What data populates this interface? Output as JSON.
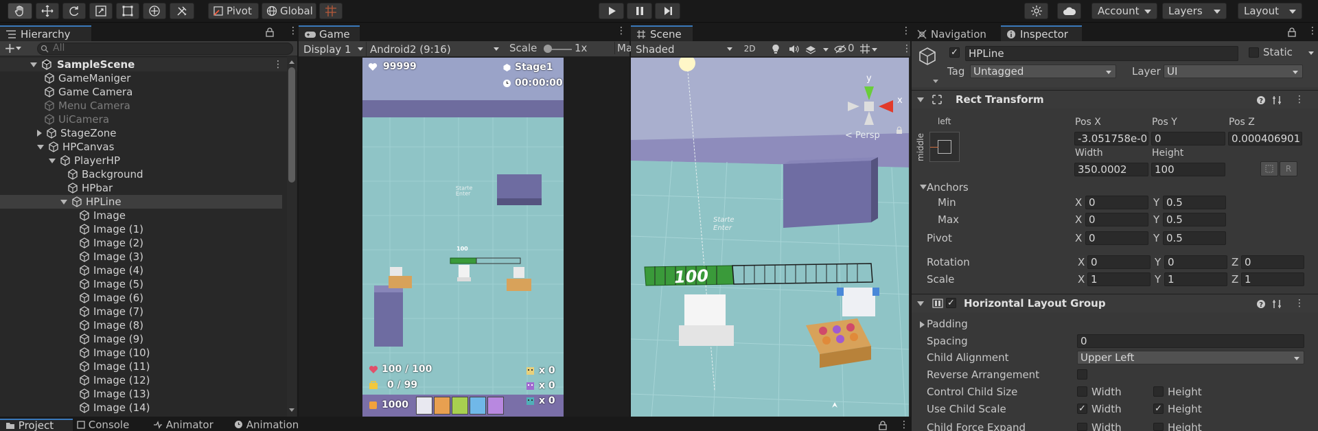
{
  "toolbar": {
    "pivot": "Pivot",
    "global": "Global",
    "account": "Account",
    "layers": "Layers",
    "layout": "Layout"
  },
  "hierarchy": {
    "title": "Hierarchy",
    "search_placeholder": "All",
    "scene": "SampleScene",
    "items": [
      {
        "label": "GameManiger",
        "depth": 1
      },
      {
        "label": "Game Camera",
        "depth": 1
      },
      {
        "label": "Menu Camera",
        "depth": 1,
        "dim": true
      },
      {
        "label": "UiCamera",
        "depth": 1,
        "dim": true
      },
      {
        "label": "StageZone",
        "depth": 1,
        "fold": "closed"
      },
      {
        "label": "HPCanvas",
        "depth": 1,
        "fold": "open"
      },
      {
        "label": "PlayerHP",
        "depth": 2,
        "fold": "open"
      },
      {
        "label": "Background",
        "depth": 3
      },
      {
        "label": "HPbar",
        "depth": 3
      },
      {
        "label": "HPLine",
        "depth": 3,
        "fold": "open",
        "selected": true
      },
      {
        "label": "Image",
        "depth": 4
      },
      {
        "label": "Image (1)",
        "depth": 4
      },
      {
        "label": "Image (2)",
        "depth": 4
      },
      {
        "label": "Image (3)",
        "depth": 4
      },
      {
        "label": "Image (4)",
        "depth": 4
      },
      {
        "label": "Image (5)",
        "depth": 4
      },
      {
        "label": "Image (6)",
        "depth": 4
      },
      {
        "label": "Image (7)",
        "depth": 4
      },
      {
        "label": "Image (8)",
        "depth": 4
      },
      {
        "label": "Image (9)",
        "depth": 4
      },
      {
        "label": "Image (10)",
        "depth": 4
      },
      {
        "label": "Image (11)",
        "depth": 4
      },
      {
        "label": "Image (12)",
        "depth": 4
      },
      {
        "label": "Image (13)",
        "depth": 4
      },
      {
        "label": "Image (14)",
        "depth": 4
      }
    ]
  },
  "game": {
    "tab": "Game",
    "display": "Display 1",
    "resolution": "Android2 (9:16)",
    "scale_label": "Scale",
    "scale_value": "1x",
    "ma": "Ma",
    "hud": {
      "hearts": "99999",
      "stage": "Stage1",
      "timer": "00:00:00",
      "hp": "100 / 100",
      "bag": "0 / 99",
      "coins": "1000",
      "c1": "x 0",
      "c2": "x 0",
      "c3": "x 0",
      "hpbar_num": "100",
      "start_sign": "Starte\nEnter"
    }
  },
  "scene": {
    "tab": "Scene",
    "shading": "Shaded",
    "mode2d": "2D",
    "hidden_count": "0",
    "persp": "< Persp",
    "axis_y": "y",
    "axis_x": "x",
    "hp_num": "100",
    "start_sign": "Starte\nEnter"
  },
  "bottom_tabs": {
    "project": "Project",
    "console": "Console",
    "animator": "Animator",
    "animation": "Animation"
  },
  "inspector": {
    "nav_tab": "Navigation",
    "tab": "Inspector",
    "object_name": "HPLine",
    "static": "Static",
    "tag_label": "Tag",
    "tag": "Untagged",
    "layer_label": "Layer",
    "layer": "UI",
    "rect": {
      "title": "Rect Transform",
      "anchor_h": "left",
      "anchor_v": "middle",
      "posx_label": "Pos X",
      "posy_label": "Pos Y",
      "posz_label": "Pos Z",
      "posx": "-3.051758e-0",
      "posy": "0",
      "posz": "0.000406901",
      "width_label": "Width",
      "height_label": "Height",
      "width": "350.0002",
      "height": "100",
      "r": "R",
      "anchors": "Anchors",
      "min": "Min",
      "max": "Max",
      "pivot": "Pivot",
      "min_x": "0",
      "min_y": "0.5",
      "max_x": "0",
      "max_y": "0.5",
      "pivot_x": "0",
      "pivot_y": "0.5",
      "rotation": "Rotation",
      "scale": "Scale",
      "rot_x": "0",
      "rot_y": "0",
      "rot_z": "0",
      "sc_x": "1",
      "sc_y": "1",
      "sc_z": "1",
      "x": "X",
      "y": "Y",
      "z": "Z"
    },
    "hlg": {
      "title": "Horizontal Layout Group",
      "padding": "Padding",
      "spacing_label": "Spacing",
      "spacing": "0",
      "align_label": "Child Alignment",
      "align": "Upper Left",
      "reverse": "Reverse Arrangement",
      "ccs": "Control Child Size",
      "ucs": "Use Child Scale",
      "cfe": "Child Force Expand",
      "w": "Width",
      "h": "Height"
    }
  }
}
